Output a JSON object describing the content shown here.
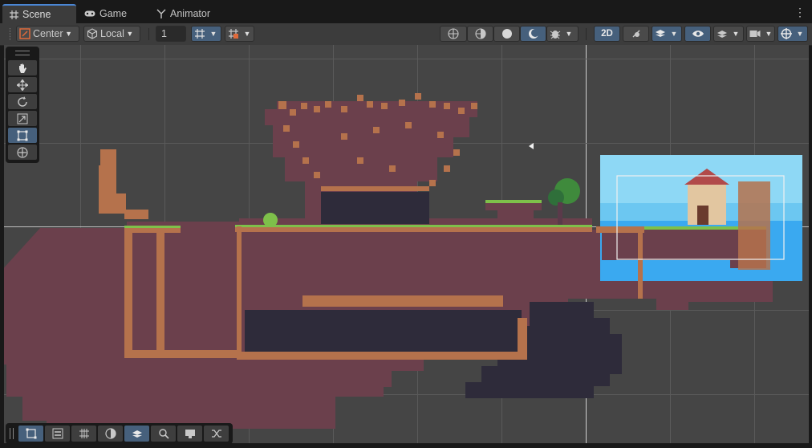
{
  "tabs": [
    {
      "label": "Scene",
      "icon": "grid-icon",
      "active": true
    },
    {
      "label": "Game",
      "icon": "gamepad-icon",
      "active": false
    },
    {
      "label": "Animator",
      "icon": "animator-icon",
      "active": false
    }
  ],
  "toolbar": {
    "pivot_mode": "Center",
    "pivot_rotation": "Local",
    "grid_snap_value": "1",
    "mode_2d_label": "2D"
  },
  "palette_tools": [
    "hand-tool",
    "move-tool",
    "rotate-tool",
    "scale-tool",
    "rect-tool",
    "transform-tool"
  ],
  "active_tool": "rect-tool",
  "bottom_tools": [
    "rect-select",
    "grid-toggle",
    "grid-snap",
    "shading-mode",
    "layers",
    "search",
    "scene-camera",
    "shuffle"
  ],
  "colors": {
    "accent": "#46607c",
    "sky": "#3aa9f0",
    "dirt": "#6b404c",
    "brick": "#b5724c",
    "grass": "#7ec04a"
  }
}
